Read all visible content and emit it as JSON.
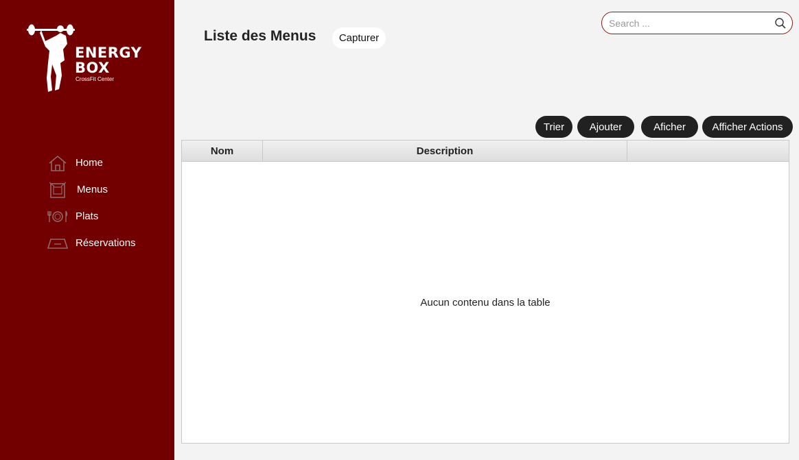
{
  "sidebar": {
    "logo": {
      "line1": "ENERGY",
      "line2": "BOX",
      "line3": "CrossFit Center",
      "icon": "weightlifter-logo"
    },
    "items": [
      {
        "label": "Home",
        "icon": "home-icon"
      },
      {
        "label": "Menus",
        "icon": "menu-board-icon"
      },
      {
        "label": "Plats",
        "icon": "cutlery-plate-icon"
      },
      {
        "label": "Réservations",
        "icon": "reservation-icon"
      }
    ],
    "bg_color": "#730000"
  },
  "header": {
    "title": "Liste des Menus",
    "capture_label": "Capturer"
  },
  "search": {
    "placeholder": "Search ...",
    "value": ""
  },
  "actions": {
    "trier": "Trier",
    "ajouter": "Ajouter",
    "aficher": "Aficher",
    "afficher_actions": "Afficher Actions"
  },
  "table": {
    "columns": [
      "Nom",
      "Description",
      ""
    ],
    "empty_message": "Aucun contenu dans la table"
  }
}
